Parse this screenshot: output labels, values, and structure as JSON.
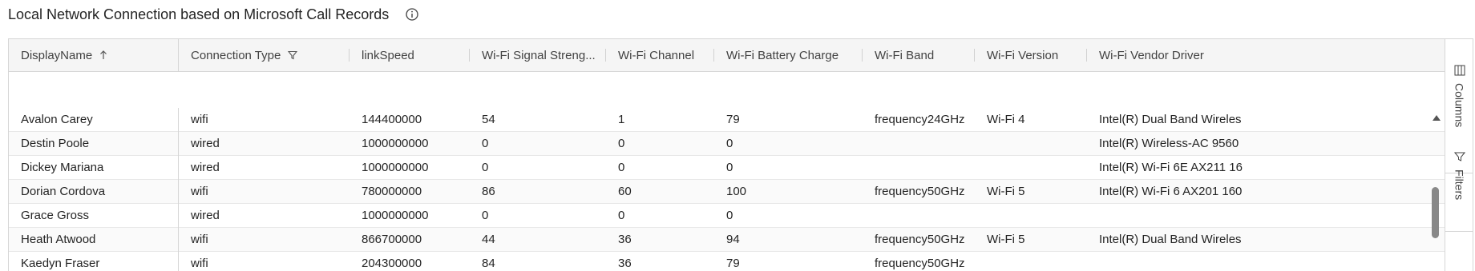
{
  "title": "Local Network Connection based on Microsoft Call Records",
  "columns": [
    {
      "label": "DisplayName",
      "icon": "sort-ascending-icon"
    },
    {
      "label": "Connection Type",
      "icon": "filter-icon"
    },
    {
      "label": "linkSpeed",
      "icon": ""
    },
    {
      "label": "Wi-Fi Signal Streng...",
      "icon": ""
    },
    {
      "label": "Wi-Fi Channel",
      "icon": ""
    },
    {
      "label": "Wi-Fi Battery Charge",
      "icon": ""
    },
    {
      "label": "Wi-Fi Band",
      "icon": ""
    },
    {
      "label": "Wi-Fi Version",
      "icon": ""
    },
    {
      "label": "Wi-Fi Vendor Driver",
      "icon": ""
    }
  ],
  "rows": [
    [
      "Avalon Carey",
      "wifi",
      "144400000",
      "54",
      "1",
      "79",
      "frequency24GHz",
      "Wi-Fi 4",
      "Intel(R) Dual Band Wireles"
    ],
    [
      "Destin Poole",
      "wired",
      "1000000000",
      "0",
      "0",
      "0",
      "",
      "",
      "Intel(R) Wireless-AC 9560"
    ],
    [
      "Dickey Mariana",
      "wired",
      "1000000000",
      "0",
      "0",
      "0",
      "",
      "",
      "Intel(R) Wi-Fi 6E AX211 16"
    ],
    [
      "Dorian Cordova",
      "wifi",
      "780000000",
      "86",
      "60",
      "100",
      "frequency50GHz",
      "Wi-Fi 5",
      "Intel(R) Wi-Fi 6 AX201 160"
    ],
    [
      "Grace Gross",
      "wired",
      "1000000000",
      "0",
      "0",
      "0",
      "",
      "",
      ""
    ],
    [
      "Heath Atwood",
      "wifi",
      "866700000",
      "44",
      "36",
      "94",
      "frequency50GHz",
      "Wi-Fi 5",
      "Intel(R) Dual Band Wireles"
    ],
    [
      "Kaedyn Fraser",
      "wifi",
      "204300000",
      "84",
      "36",
      "79",
      "frequency50GHz",
      "",
      ""
    ]
  ],
  "side_panel": {
    "columns_label": "Columns",
    "filters_label": "Filters"
  },
  "scroll_position": 0.45
}
